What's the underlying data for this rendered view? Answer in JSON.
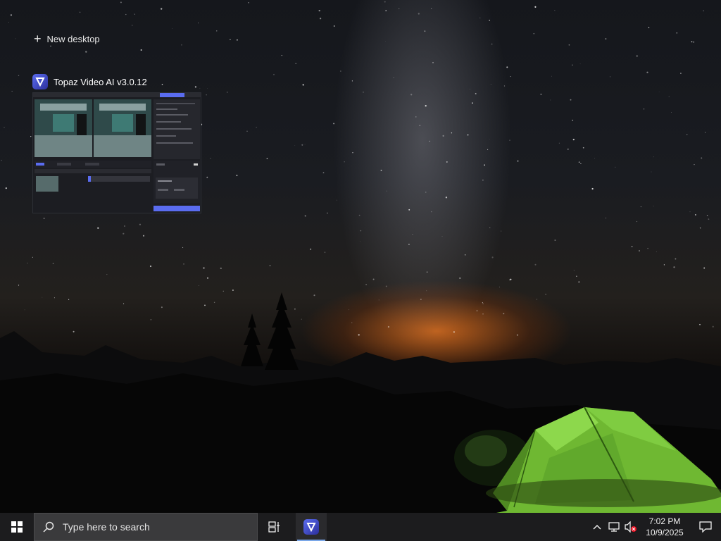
{
  "task_view": {
    "new_desktop_label": "New desktop",
    "window": {
      "title": "Topaz Video AI  v3.0.12",
      "thumbnail_export_label": "Export"
    }
  },
  "taskbar": {
    "search_placeholder": "Type here to search",
    "clock_time": "7:02 PM",
    "clock_date": "10/9/2025"
  },
  "colors": {
    "taskbar_bg": "#1c1c1e",
    "search_bg": "#3a3a3c",
    "topaz_accent": "#5a6cf0",
    "tent_green": "#7bd43a",
    "horizon_orange": "#dc6e1e"
  },
  "icons": [
    "plus-icon",
    "topaz-logo-icon",
    "windows-start-icon",
    "search-icon",
    "task-view-icon",
    "chevron-up-icon",
    "network-icon",
    "volume-muted-icon",
    "notification-icon"
  ]
}
